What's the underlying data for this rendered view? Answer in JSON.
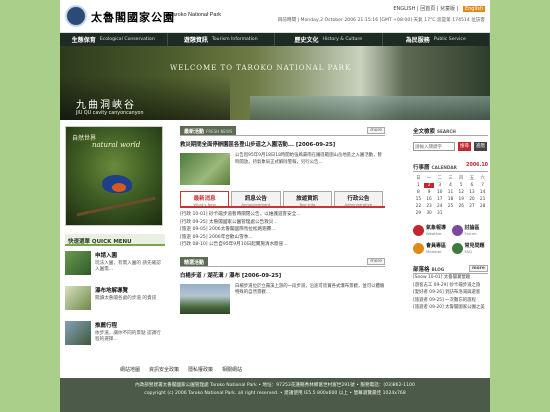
{
  "header": {
    "logo_cn": "太魯閣國家公園",
    "logo_en": "Taroko National Park",
    "top_links": "ENGLISH | 回首頁 | 兒童版 |",
    "en_button": "English",
    "date_text": "目前時間 | Monday,2 October 2006 21:15:16 [GMT +08:00] 天氣 17°C  您是第 174514 位訪客"
  },
  "nav": [
    {
      "cn": "生態保育",
      "en": "Ecological Conservation"
    },
    {
      "cn": "遊憩資訊",
      "en": "Tourism Information"
    },
    {
      "cn": "歷史文化",
      "en": "History & Culture"
    },
    {
      "cn": "為民服務",
      "en": "Public Service"
    }
  ],
  "banner": {
    "title": "WELCOME TO TAROKO NATIONAL PARK",
    "location_cn": "九曲洞峽谷",
    "location_en": "JIU QU cavity canyoncanyon"
  },
  "feature": {
    "caption_cn": "自然世界",
    "caption_en": "natural world"
  },
  "quick_menu": {
    "title": "快速選單 QUICK MENU",
    "items": [
      {
        "title": "申請入園",
        "desc": "玩法入園，有需入園的 請先確認入園需..."
      },
      {
        "title": "瀑布地解導覽",
        "desc": "閱讀太魯閣各處的步道 的資訊"
      },
      {
        "title": "推薦行程",
        "desc": "依步道，讓你不同的景點 認識行程的選擇..."
      }
    ]
  },
  "news": {
    "tag": "最新活動",
    "tag_en": "FRESH NEWS",
    "more": "more",
    "title": "救災期間全面停辦園區各登山步道之入園活動...   [2006-09-25]",
    "body": "公告因95年9月18日18時開始強風豪雨在園區範圍山岳地區之入園活動，暫時開放，待氣象局正式解除警報，另行公告..."
  },
  "tabs": [
    {
      "cn": "最新消息",
      "en": "What's New",
      "active": true
    },
    {
      "cn": "訊息公告",
      "en": "Announcement",
      "active": false
    },
    {
      "cn": "旅遊資訊",
      "en": "Tour Info",
      "active": false
    },
    {
      "cn": "行政公告",
      "en": "Administrative",
      "active": false
    }
  ],
  "news_list": [
    "[行政 10-01] 砂卡礑步道暫時關閉公告，以維護遊客安全...",
    "[行政 09-25] 太魯閣國家公園管理處公告救災...",
    "[旅遊 09-05] 2006太魯閣國際馬拉松路跑賽...",
    "[旅遊 09-25] 2006年合歡山雪季...",
    "[行政 08-10] 公告自95年9月10日起實施清水斷崖..."
  ],
  "post": {
    "tag": "精選活動",
    "tag_en": "",
    "more": "more",
    "title": "白楊步道 / 湖花溝 / 瀑布 [2006-09-25]",
    "body": "白楊步道位於立霧溪上游的一段步道，沿途可欣賞各式瀑布景觀，並可以體驗特殊的自然景觀..."
  },
  "search": {
    "title": "全文檢索",
    "title_en": "SEARCH",
    "placeholder": "請輸入關鍵字",
    "btn1": "搜尋",
    "btn2": "進階"
  },
  "calendar": {
    "title": "行事曆",
    "title_en": "CALENDAR",
    "month": "2006.10",
    "weekdays": [
      "日",
      "一",
      "二",
      "三",
      "四",
      "五",
      "六"
    ],
    "days": [
      "1",
      "2",
      "3",
      "4",
      "5",
      "6",
      "7",
      "8",
      "9",
      "10",
      "11",
      "12",
      "13",
      "14",
      "15",
      "16",
      "17",
      "18",
      "19",
      "20",
      "21",
      "22",
      "23",
      "24",
      "25",
      "26",
      "27",
      "28",
      "29",
      "30",
      "31"
    ],
    "today": "2"
  },
  "services": [
    {
      "cn": "氣象報導",
      "en": "Weather",
      "color": "#c3262e"
    },
    {
      "cn": "討論區",
      "en": "Forum",
      "color": "#7a4a9e"
    },
    {
      "cn": "會員專區",
      "en": "Member",
      "color": "#e08a1c"
    },
    {
      "cn": "常見問題",
      "en": "FAQ",
      "color": "#3d7a3d"
    }
  ],
  "blog": {
    "title": "部落格",
    "title_en": "BLOG",
    "more": "more",
    "items": [
      "[Snow 10-01] 太魯閣賞螢趣",
      "[遊客志工 09-29] 砂卡礑步道之旅",
      "[愛好者 09-26] 到訪布洛灣與遊客",
      "[旅遊者 09-25] 一次難忘的旅程",
      "[旅遊者 09-20] 太魯閣國家公園之美"
    ]
  },
  "footer_links": [
    "網站地圖",
    "資訊安全政策",
    "隱私權政策",
    "相關網站"
  ],
  "footer": {
    "line1": "內政部營建署太魯閣國家公園管理處 Taroko National Park • 地址：97253花蓮縣秀林鄉富世村富世291號 • 服務電話：(03)862-1100",
    "line2": "copyright (c) 2006 Taroko National Park. all right reserved. • 建議使用 IE5.5 800x600 以上 • 螢幕瀏覽最佳 1024x768"
  }
}
